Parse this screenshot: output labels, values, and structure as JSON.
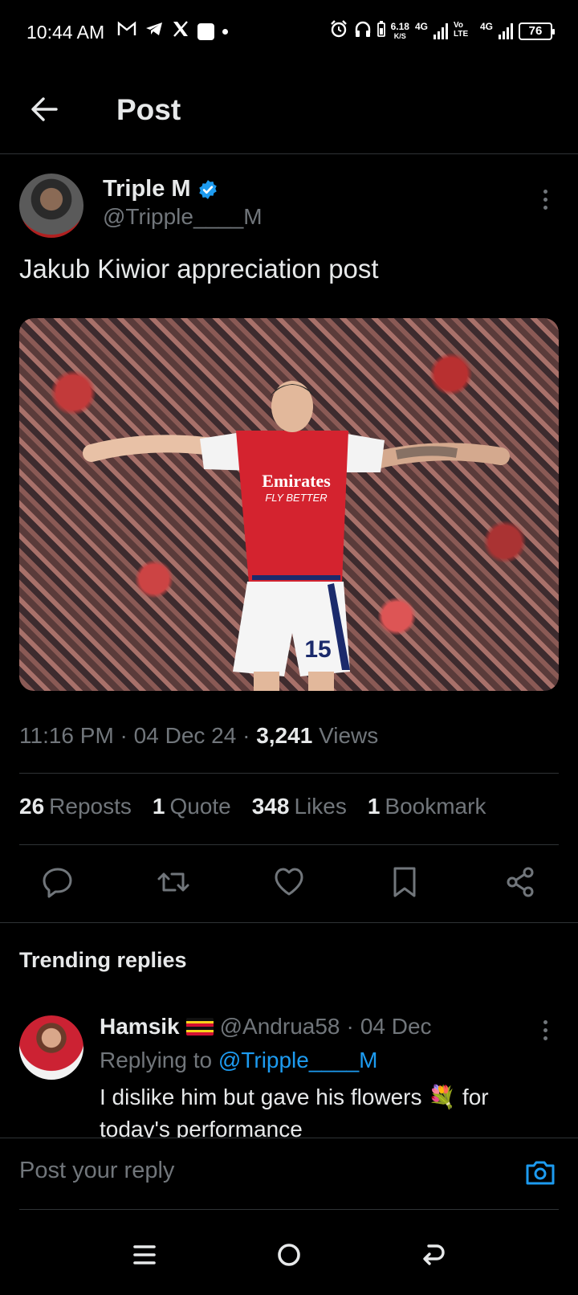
{
  "status_bar": {
    "time": "10:44 AM",
    "left_icons": [
      "gmail-icon",
      "telegram-icon",
      "x-icon",
      "app-icon",
      "dot-icon"
    ],
    "net_speed_value": "6.18",
    "net_speed_unit": "K/S",
    "network_1": "4G",
    "volte": "Vo LTE",
    "network_2": "4G",
    "battery": "76"
  },
  "header": {
    "title": "Post"
  },
  "post": {
    "author_name": "Triple M",
    "author_handle": "@Tripple____M",
    "text": "Jakub Kiwior appreciation post",
    "image_shirt_sponsor": "Emirates",
    "image_shirt_tagline": "FLY BETTER",
    "image_shorts_number": "15",
    "time": "11:16 PM",
    "date": "04 Dec 24",
    "views_count": "3,241",
    "views_label": "Views",
    "stats": {
      "reposts_count": "26",
      "reposts_label": "Reposts",
      "quotes_count": "1",
      "quotes_label": "Quote",
      "likes_count": "348",
      "likes_label": "Likes",
      "bookmarks_count": "1",
      "bookmarks_label": "Bookmark"
    }
  },
  "trending": {
    "title": "Trending replies"
  },
  "reply": {
    "name": "Hamsik",
    "handle": "@Andrua58",
    "date": "04 Dec",
    "replying_prefix": "Replying to",
    "replying_to": "@Tripple____M",
    "text": "I dislike him but gave his flowers 💐 for today's performance"
  },
  "composer": {
    "placeholder": "Post your reply"
  },
  "colors": {
    "accent": "#1d9bf0",
    "muted": "#71767b",
    "text": "#e7e9ea",
    "divider": "#2f3336",
    "background": "#000000"
  }
}
